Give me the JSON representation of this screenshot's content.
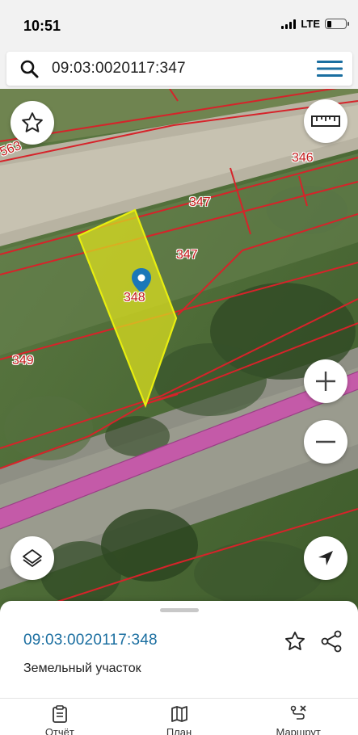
{
  "status_bar": {
    "time": "10:51",
    "network": "LTE",
    "battery_level": 0.25
  },
  "search": {
    "query": "09:03:0020117:347",
    "search_icon": "search-icon",
    "menu_icon": "hamburger-menu-icon"
  },
  "map": {
    "parcel_labels": [
      "563",
      "346",
      "347",
      "347",
      "348",
      "349"
    ],
    "selected_parcel_color": "#d9de1f",
    "boundary_color": "#d6232a",
    "path_color": "#c45aa8",
    "pin_color": "#1a77b8",
    "buttons": {
      "favorite": "star-icon",
      "ruler": "ruler-icon",
      "zoom_in": "+",
      "zoom_out": "−",
      "layers": "layers-icon",
      "locate": "navigation-arrow-icon"
    }
  },
  "sheet": {
    "title": "09:03:0020117:348",
    "subtitle": "Земельный участок"
  },
  "tabs": [
    {
      "label": "Отчёт",
      "icon": "clipboard-icon"
    },
    {
      "label": "План",
      "icon": "map-icon"
    },
    {
      "label": "Маршрут",
      "icon": "route-icon"
    }
  ]
}
